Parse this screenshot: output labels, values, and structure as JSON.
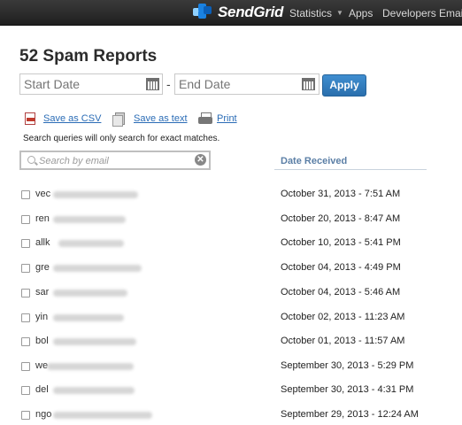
{
  "topbar": {
    "brand": "SendGrid",
    "nav": [
      {
        "label": "Statistics",
        "has_caret": true
      },
      {
        "label": "Apps",
        "has_caret": false
      },
      {
        "label": "Developers",
        "has_caret": false
      },
      {
        "label": "Email",
        "has_caret": false
      }
    ]
  },
  "page": {
    "title": "52 Spam Reports"
  },
  "filters": {
    "start_placeholder": "Start Date",
    "end_placeholder": "End Date",
    "separator": "-",
    "apply_label": "Apply"
  },
  "actions": {
    "csv_label": "Save as CSV",
    "text_label": "Save as text",
    "print_label": "Print"
  },
  "search": {
    "hint": "Search queries will only search for exact matches.",
    "placeholder": "Search by email",
    "clear_glyph": "✕"
  },
  "table": {
    "date_header": "Date Received",
    "rows": [
      {
        "email_prefix": "vec",
        "date": "October 31, 2013 - 7:51 AM"
      },
      {
        "email_prefix": "ren",
        "date": "October 20, 2013 - 8:47 AM"
      },
      {
        "email_prefix": "allk",
        "date": "October 10, 2013 - 5:41 PM"
      },
      {
        "email_prefix": "gre",
        "date": "October 04, 2013 - 4:49 PM"
      },
      {
        "email_prefix": "sar",
        "date": "October 04, 2013 - 5:46 AM"
      },
      {
        "email_prefix": "yin",
        "date": "October 02, 2013 - 11:23 AM"
      },
      {
        "email_prefix": "bol",
        "date": "October 01, 2013 - 11:57 AM"
      },
      {
        "email_prefix": "we",
        "date": "September 30, 2013 - 5:29 PM"
      },
      {
        "email_prefix": "del",
        "date": "September 30, 2013 - 4:31 PM"
      },
      {
        "email_prefix": "ngo",
        "date": "September 29, 2013 - 12:24 AM"
      }
    ]
  },
  "colors": {
    "accent": "#2a6fad",
    "link": "#2a6cb6",
    "header_text": "#5b7fa6",
    "topbar": "#2b2b2b",
    "logo_blue": "#1a82e2"
  }
}
